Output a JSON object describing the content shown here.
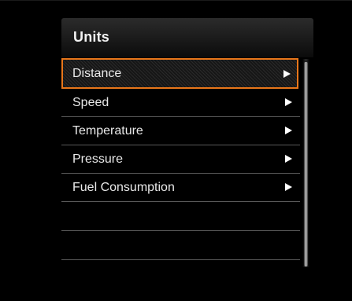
{
  "header": {
    "title": "Units"
  },
  "menu": {
    "items": [
      {
        "label": "Distance",
        "selected": true
      },
      {
        "label": "Speed"
      },
      {
        "label": "Temperature"
      },
      {
        "label": "Pressure"
      },
      {
        "label": "Fuel Consumption"
      }
    ],
    "item_icon": "right-triangle-arrow-icon"
  },
  "colors": {
    "background": "#000000",
    "selection_border": "#e8761a",
    "text": "#e9e9e9",
    "divider": "#5a5a5a"
  }
}
